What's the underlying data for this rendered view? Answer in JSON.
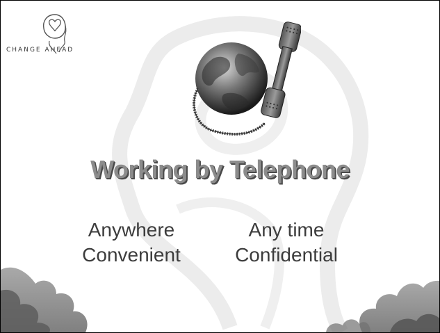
{
  "logo": {
    "text": "CHANGE AHEAD"
  },
  "title": "Working by Telephone",
  "features": [
    "Anywhere",
    "Any time",
    "Convenient",
    "Confidential"
  ],
  "colors": {
    "title": "#8c8c8c",
    "title_shadow": "#4a4a4a",
    "body_text": "#3c3c3c",
    "watermark": "#eeeeee"
  },
  "icons": {
    "logo": "head-heart-logo-icon",
    "illustration": "globe-telephone-icon"
  }
}
